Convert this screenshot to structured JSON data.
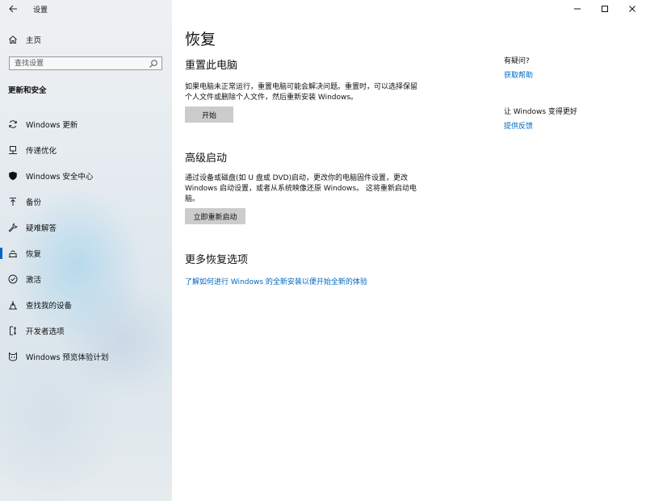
{
  "app": {
    "title": "设置"
  },
  "sidebar": {
    "home_label": "主页",
    "search_placeholder": "查找设置",
    "section_title": "更新和安全",
    "items": [
      {
        "label": "Windows 更新",
        "icon": "sync-icon"
      },
      {
        "label": "传递优化",
        "icon": "delivery-optimization-icon"
      },
      {
        "label": "Windows 安全中心",
        "icon": "shield-icon"
      },
      {
        "label": "备份",
        "icon": "backup-icon"
      },
      {
        "label": "疑难解答",
        "icon": "wrench-icon"
      },
      {
        "label": "恢复",
        "icon": "recovery-icon",
        "selected": true
      },
      {
        "label": "激活",
        "icon": "activation-check-icon"
      },
      {
        "label": "查找我的设备",
        "icon": "find-device-icon"
      },
      {
        "label": "开发者选项",
        "icon": "developer-icon"
      },
      {
        "label": "Windows 预览体验计划",
        "icon": "insider-cat-icon"
      }
    ]
  },
  "main": {
    "title": "恢复",
    "reset": {
      "heading": "重置此电脑",
      "desc_line1": "如果电脑未正常运行，重置电脑可能会解决问题。重置时，可以选择保留",
      "desc_line2": "个人文件或删除个人文件，然后重新安装 Windows。",
      "button": "开始"
    },
    "advanced": {
      "heading": "高级启动",
      "desc_line1": "通过设备或磁盘(如 U 盘或 DVD)启动，更改你的电脑固件设置，更改",
      "desc_line2": "Windows 启动设置，或者从系统映像还原 Windows。 这将重新启动电",
      "desc_line3": "脑。",
      "button": "立即重新启动"
    },
    "more": {
      "heading": "更多恢复选项",
      "link": "了解如何进行 Windows 的全新安装以便开始全新的体验"
    }
  },
  "aside": {
    "question": "有疑问?",
    "help_link": "获取帮助",
    "improve": "让 Windows 变得更好",
    "feedback_link": "提供反馈"
  },
  "colors": {
    "accent": "#0067c0",
    "button_bg": "#cccccc"
  }
}
